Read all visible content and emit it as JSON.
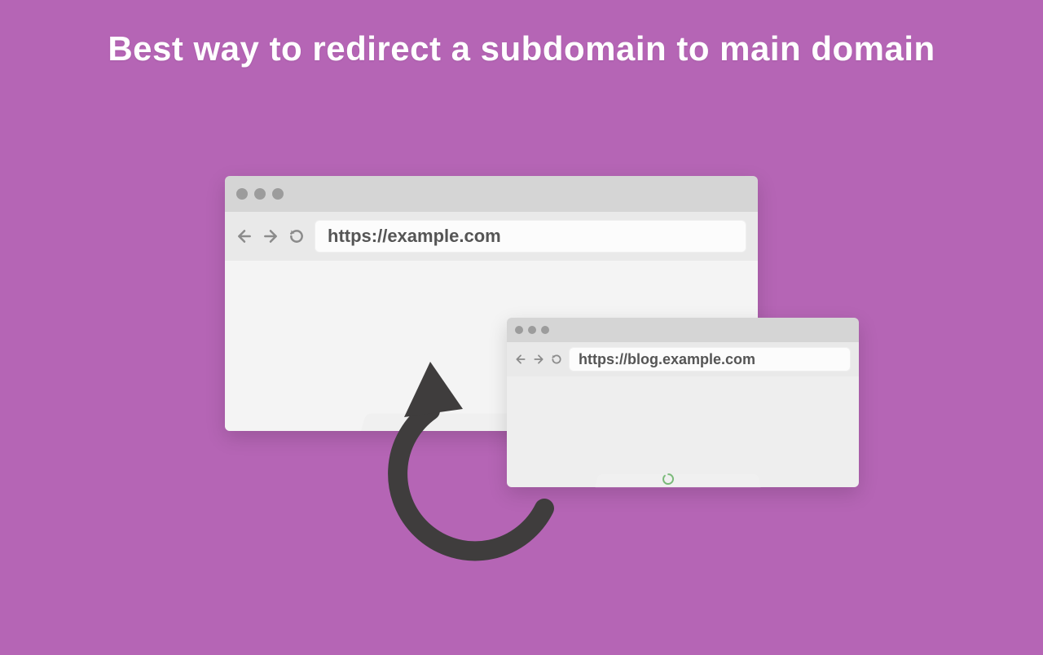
{
  "title": "Best way to redirect a subdomain to main domain",
  "colors": {
    "background": "#b565b5",
    "arrow": "#3f3d3d",
    "spinner": "#79b978"
  },
  "main_window": {
    "url": "https://example.com"
  },
  "sub_window": {
    "url": "https://blog.example.com"
  }
}
